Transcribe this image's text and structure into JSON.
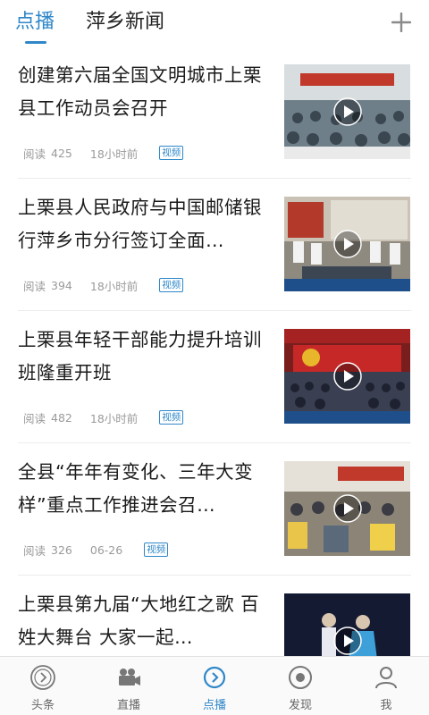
{
  "header": {
    "tabs": [
      {
        "label": "点播",
        "active": true
      },
      {
        "label": "萍乡新闻",
        "active": false
      }
    ],
    "add_icon": "plus-icon"
  },
  "feed": {
    "views_label": "阅读",
    "items": [
      {
        "title": "创建第六届全国文明城市上栗县工作动员会召开",
        "views": "425",
        "time": "18小时前",
        "badge": "视频"
      },
      {
        "title": "上栗县人民政府与中国邮储银行萍乡市分行签订全面…",
        "views": "394",
        "time": "18小时前",
        "badge": "视频"
      },
      {
        "title": "上栗县年轻干部能力提升培训班隆重开班",
        "views": "482",
        "time": "18小时前",
        "badge": "视频"
      },
      {
        "title": "全县“年年有变化、三年大变样”重点工作推进会召…",
        "views": "326",
        "time": "06-26",
        "badge": "视频"
      },
      {
        "title": "上栗县第九届“大地红之歌 百姓大舞台 大家一起…",
        "views": "",
        "time": "",
        "badge": ""
      }
    ]
  },
  "bottom_nav": [
    {
      "label": "头条",
      "icon": "headline-icon",
      "active": false
    },
    {
      "label": "直播",
      "icon": "video-camera-icon",
      "active": false
    },
    {
      "label": "点播",
      "icon": "play-circle-icon",
      "active": true
    },
    {
      "label": "发现",
      "icon": "discover-icon",
      "active": false
    },
    {
      "label": "我",
      "icon": "user-icon",
      "active": false
    }
  ],
  "colors": {
    "accent": "#2f87c8",
    "text": "#1a1a1a",
    "meta": "#9a9a9a"
  }
}
